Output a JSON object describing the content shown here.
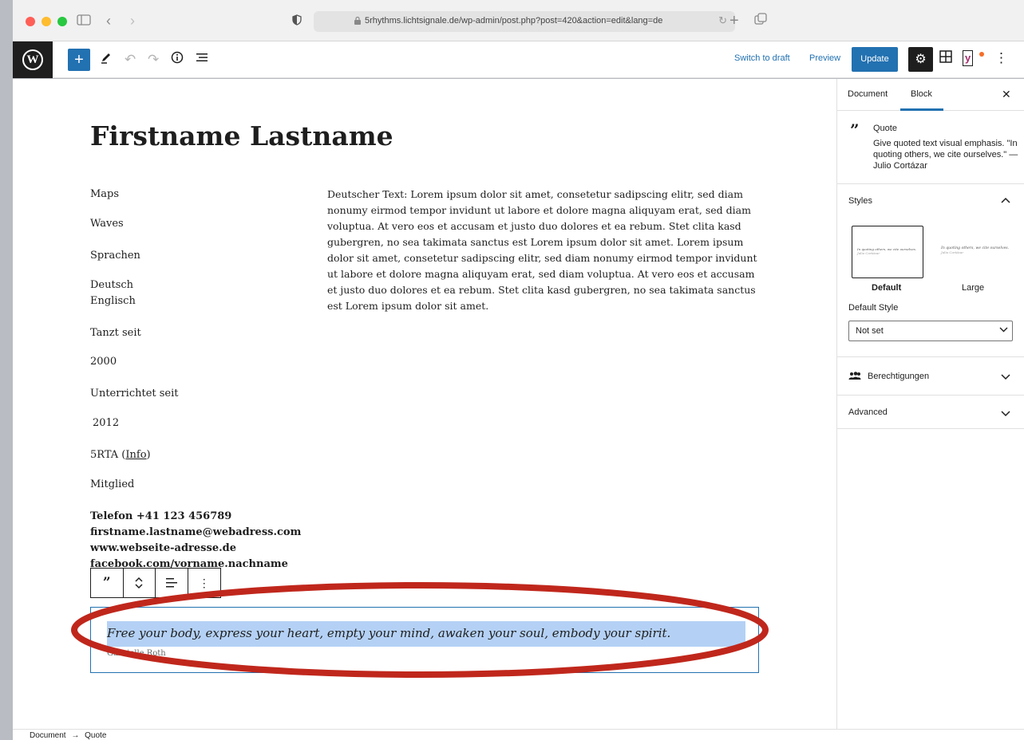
{
  "browser": {
    "url": "5rhythms.lichtsignale.de/wp-admin/post.php?post=420&action=edit&lang=de"
  },
  "toolbar": {
    "switch_to_draft": "Switch to draft",
    "preview": "Preview",
    "update": "Update"
  },
  "post": {
    "title": "Firstname Lastname",
    "left_column": [
      "Maps",
      "Waves",
      "Sprachen",
      "Deutsch",
      "Englisch",
      "Tanzt seit",
      "2000",
      "Unterrichtet seit",
      "2012",
      "5RTA (",
      "Info",
      ")",
      "Mitglied"
    ],
    "contact": [
      "Telefon +41 123 456789",
      "firstname.lastname@webadress.com",
      "www.webseite-adresse.de",
      "facebook.com/vorname.nachname"
    ],
    "paragraph": "Deutscher Text: Lorem ipsum dolor sit amet, consetetur sadipscing elitr, sed diam nonumy eirmod tempor invidunt ut labore et dolore magna aliquyam erat, sed diam voluptua. At vero eos et accusam et justo duo dolores et ea rebum. Stet clita kasd gubergren, no sea takimata sanctus est Lorem ipsum dolor sit amet. Lorem ipsum dolor sit amet, consetetur sadipscing elitr, sed diam nonumy eirmod tempor invidunt ut labore et dolore magna aliquyam erat, sed diam voluptua. At vero eos et accusam et justo duo dolores et ea rebum. Stet clita kasd gubergren, no sea takimata sanctus est Lorem ipsum dolor sit amet.",
    "quote": {
      "text": "Free your body, express your heart, empty your mind, awaken your soul, embody your spirit.",
      "citation": "Gabrielle Roth"
    }
  },
  "sidebar": {
    "tabs": [
      "Document",
      "Block"
    ],
    "active_tab": "Block",
    "block_card": {
      "title": "Quote",
      "description": "Give quoted text visual emphasis. \"In quoting others, we cite ourselves.\" — Julio Cortázar"
    },
    "styles": {
      "title": "Styles",
      "options": [
        "Default",
        "Large"
      ],
      "preview_text": "In quoting others, we cite ourselves.",
      "preview_cite": "Julio Cortázar",
      "default_style_label": "Default Style",
      "default_style_value": "Not set"
    },
    "permissions": "Berechtigungen",
    "advanced": "Advanced"
  },
  "breadcrumb": {
    "items": [
      "Document",
      "Quote"
    ],
    "separator": "→"
  },
  "colors": {
    "accent": "#2271b1",
    "highlight_ellipse": "#c0271c",
    "selection": "#b4d1f5"
  }
}
